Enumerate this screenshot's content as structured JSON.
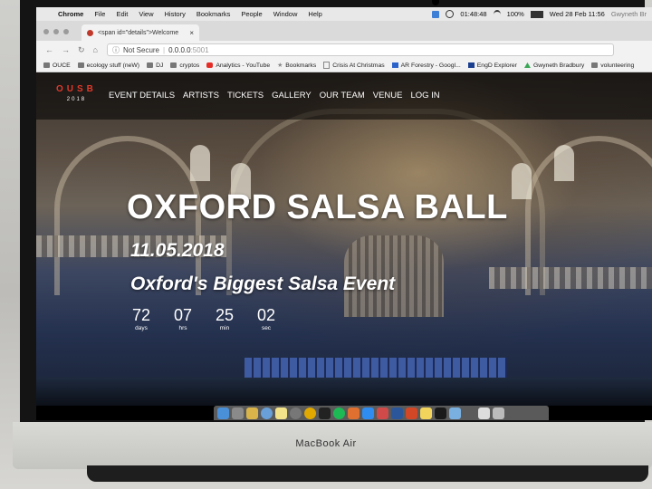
{
  "laptop": {
    "brand_label": "MacBook Air"
  },
  "menubar": {
    "apple_glyph": "",
    "items": [
      "Chrome",
      "File",
      "Edit",
      "View",
      "History",
      "Bookmarks",
      "People",
      "Window",
      "Help"
    ],
    "time": "01:48:48",
    "battery": "100%",
    "datetime": "Wed 28 Feb  11:56",
    "user": "Gwyneth Br"
  },
  "browser": {
    "tab_title": "<span id=\"details\">Welcome",
    "tab_close": "×",
    "security_label": "Not Secure",
    "separator": "|",
    "url_host": "0.0.0.0",
    "url_port": ":5001"
  },
  "bookmarks": [
    {
      "label": "OUCE",
      "icon": "folder-icon"
    },
    {
      "label": "ecology stuff (neW)",
      "icon": "folder-icon"
    },
    {
      "label": "DJ",
      "icon": "folder-icon"
    },
    {
      "label": "cryptos",
      "icon": "folder-icon"
    },
    {
      "label": "Analytics - YouTube",
      "icon": "youtube-icon"
    },
    {
      "label": "Bookmarks",
      "icon": "star-icon"
    },
    {
      "label": "Crisis At Christmas",
      "icon": "page-icon"
    },
    {
      "label": "AR Forestry - Googl...",
      "icon": "page-icon"
    },
    {
      "label": "EngD Explorer",
      "icon": "page-icon"
    },
    {
      "label": "Gwyneth Bradbury",
      "icon": "drive-icon"
    },
    {
      "label": "volunteering",
      "icon": "folder-icon"
    }
  ],
  "site": {
    "logo_top": "OUSB",
    "logo_year": "2018",
    "nav": [
      "EVENT DETAILS",
      "ARTISTS",
      "TICKETS",
      "GALLERY",
      "OUR TEAM",
      "VENUE",
      "LOG IN"
    ],
    "title": "OXFORD SALSA BALL",
    "date": "11.05.2018",
    "subtitle": "Oxford's Biggest Salsa Event",
    "countdown": [
      {
        "value": "72",
        "unit": "days"
      },
      {
        "value": "07",
        "unit": "hrs"
      },
      {
        "value": "25",
        "unit": "min"
      },
      {
        "value": "02",
        "unit": "sec"
      }
    ]
  },
  "colors": {
    "logo_accent": "#e0392b",
    "menubar_bg": "#e8e8e8",
    "nav_overlay": "rgba(0,0,0,0.55)"
  }
}
